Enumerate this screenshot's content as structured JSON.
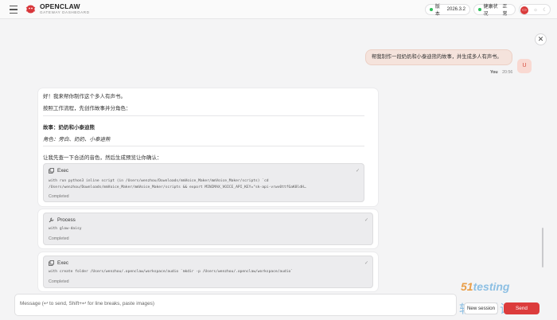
{
  "brand": {
    "name": "OPENCLAW",
    "subtitle": "GATEWAY DASHBOARD"
  },
  "header": {
    "version_label": "版本",
    "version_value": "2026.3.2",
    "health_label": "健康状况",
    "health_value": "正常"
  },
  "user_message": {
    "text": "帮我制作一段奶奶和小泰迪熊的故事，并生成多人有声书。",
    "avatar": "U",
    "author": "You",
    "time": "20:56"
  },
  "assistant": {
    "line1": "好！我来帮你制作这个多人有声书。",
    "line2": "按照工作流程，先创作故事并分角色：",
    "story_title": "故事：奶奶和小泰迪熊",
    "roles": "角色：旁白、奶奶、小泰迪熊",
    "line3": "让我先查一下合适的音色，然后生成预览让你确认："
  },
  "tools": [
    {
      "name": "Exec",
      "detail_line1": "with run python3 inline script (in /Users/wenzhou/Downloads/mmVoice_Maker/mmVoice_Maker/scripts) `cd",
      "detail_line2": "/Users/wenzhou/Downloads/mmVoice_Maker/mmVoice_Maker/scripts && export MINIMAX_VOICE_API_KEY=\"sk-api-vrwv0ttfGaK8ldH…",
      "status": "Completed"
    },
    {
      "name": "Process",
      "detail_line1": "with glow-daisy",
      "status": "Completed"
    },
    {
      "name": "Exec",
      "detail_line1": "with create folder /Users/wenzhou/.openclaw/workspace/audio `mkdir -p /Users/wenzhou/.openclaw/workspace/audio`",
      "status": "Completed"
    }
  ],
  "composer": {
    "placeholder": "Message (↩ to send, Shift+↩ for line breaks, paste images)",
    "new_session_label": "New session",
    "send_label": "Send"
  },
  "watermark": {
    "top": "51testing",
    "bottom": "软件测试网"
  },
  "colors": {
    "accent": "#dc3c3c",
    "status_ok": "#2fbf5b",
    "user_bubble": "#f5e3dc"
  }
}
